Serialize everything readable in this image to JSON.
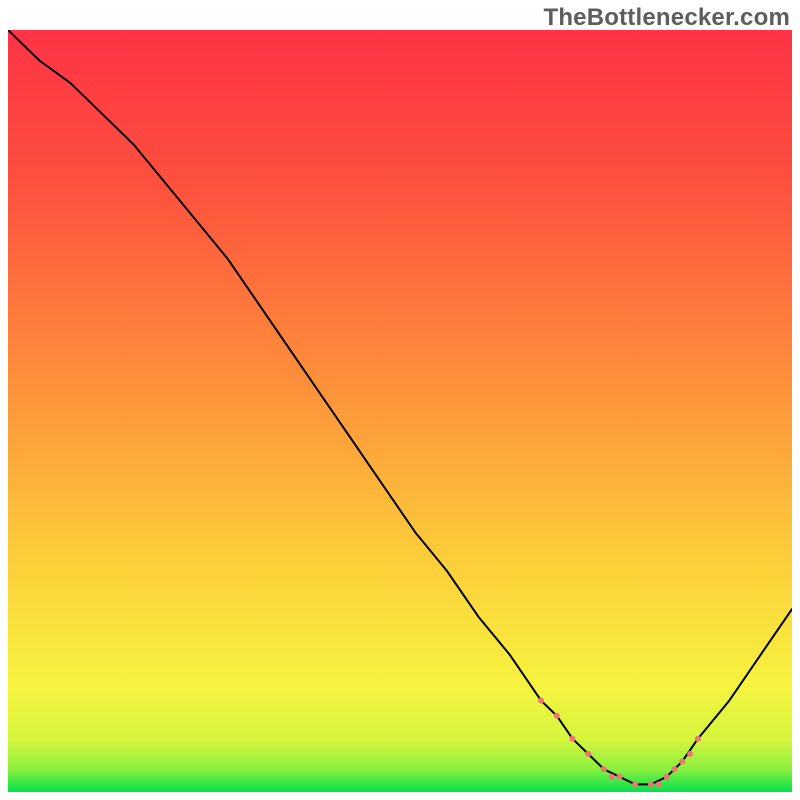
{
  "watermark": "TheBottlenecker.com",
  "chart_data": {
    "type": "line",
    "title": "",
    "xlabel": "",
    "ylabel": "",
    "xlim": [
      0,
      100
    ],
    "ylim": [
      0,
      100
    ],
    "background_gradient": {
      "stops": [
        {
          "pct": 0,
          "color": "#00e24c"
        },
        {
          "pct": 3,
          "color": "#8cef3e"
        },
        {
          "pct": 7,
          "color": "#d7f53e"
        },
        {
          "pct": 14,
          "color": "#f6f33f"
        },
        {
          "pct": 30,
          "color": "#fccf3a"
        },
        {
          "pct": 55,
          "color": "#fd8d3a"
        },
        {
          "pct": 80,
          "color": "#fd503e"
        },
        {
          "pct": 100,
          "color": "#fe3346"
        }
      ]
    },
    "series": [
      {
        "name": "curve",
        "stroke": "#000000",
        "stroke_width": 2,
        "x": [
          0,
          4,
          8,
          12,
          16,
          20,
          24,
          28,
          32,
          36,
          40,
          44,
          48,
          52,
          56,
          60,
          64,
          68,
          70,
          72,
          74,
          76,
          78,
          80,
          82,
          84,
          86,
          88,
          92,
          96,
          100
        ],
        "y": [
          100,
          96,
          93,
          89,
          85,
          80,
          75,
          70,
          64,
          58,
          52,
          46,
          40,
          34,
          29,
          23,
          18,
          12,
          10,
          7,
          5,
          3,
          2,
          1,
          1,
          2,
          4,
          7,
          12,
          18,
          24
        ]
      },
      {
        "name": "optimal-band-marker",
        "stroke": "#eb7672",
        "stroke_width": 6,
        "dash": [
          2,
          12
        ],
        "linecap": "round",
        "x": [
          68,
          70,
          72,
          74,
          76,
          77,
          78,
          80,
          82,
          83,
          84,
          85,
          86,
          87,
          88
        ],
        "y": [
          12,
          10,
          7,
          5,
          3,
          2,
          2,
          1,
          1,
          1,
          2,
          3,
          4,
          5,
          7
        ]
      }
    ]
  }
}
